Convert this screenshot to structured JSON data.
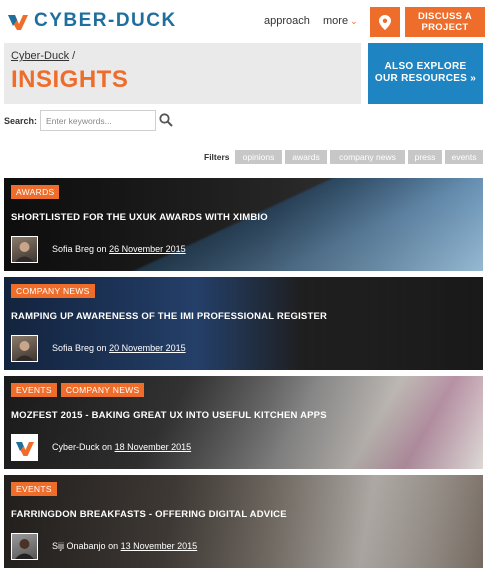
{
  "header": {
    "logo_text": "CYBER-DUCK",
    "nav": [
      {
        "label": "approach"
      },
      {
        "label": "more",
        "chevron": "⌄"
      }
    ],
    "pin_icon": "map-pin-icon",
    "discuss_line1": "DISCUSS A",
    "discuss_line2": "PROJECT"
  },
  "breadcrumb": {
    "home": "Cyber-Duck",
    "separator": "/",
    "title": "INSIGHTS"
  },
  "explore": {
    "line1": "ALSO EXPLORE",
    "line2": "OUR RESOURCES »"
  },
  "search": {
    "label": "Search:",
    "placeholder": "Enter keywords..."
  },
  "filters": {
    "label": "Filters",
    "tags": [
      "opinions",
      "awards",
      "company news",
      "press",
      "events"
    ]
  },
  "posts": [
    {
      "badges": [
        "AWARDS"
      ],
      "title": "SHORTLISTED FOR THE UXUK AWARDS WITH XIMBIO",
      "author": "Sofia Breg",
      "on": "on",
      "date": "26 November 2015"
    },
    {
      "badges": [
        "COMPANY NEWS"
      ],
      "title": "RAMPING UP AWARENESS OF THE IMI PROFESSIONAL REGISTER",
      "author": "Sofia Breg",
      "on": "on",
      "date": "20 November 2015"
    },
    {
      "badges": [
        "EVENTS",
        "COMPANY NEWS"
      ],
      "title": "MOZFEST 2015 - BAKING GREAT UX INTO USEFUL KITCHEN APPS",
      "author": "Cyber-Duck",
      "on": "on",
      "date": "18 November 2015"
    },
    {
      "badges": [
        "EVENTS"
      ],
      "title": "FARRINGDON BREAKFASTS - OFFERING DIGITAL ADVICE",
      "author": "Siji Onabanjo",
      "on": "on",
      "date": "13 November 2015"
    }
  ],
  "colors": {
    "accent": "#ee6d2b",
    "brand_blue": "#1f6f9e",
    "explore_blue": "#1f85c2",
    "tag_grey": "#c7c7c7"
  }
}
